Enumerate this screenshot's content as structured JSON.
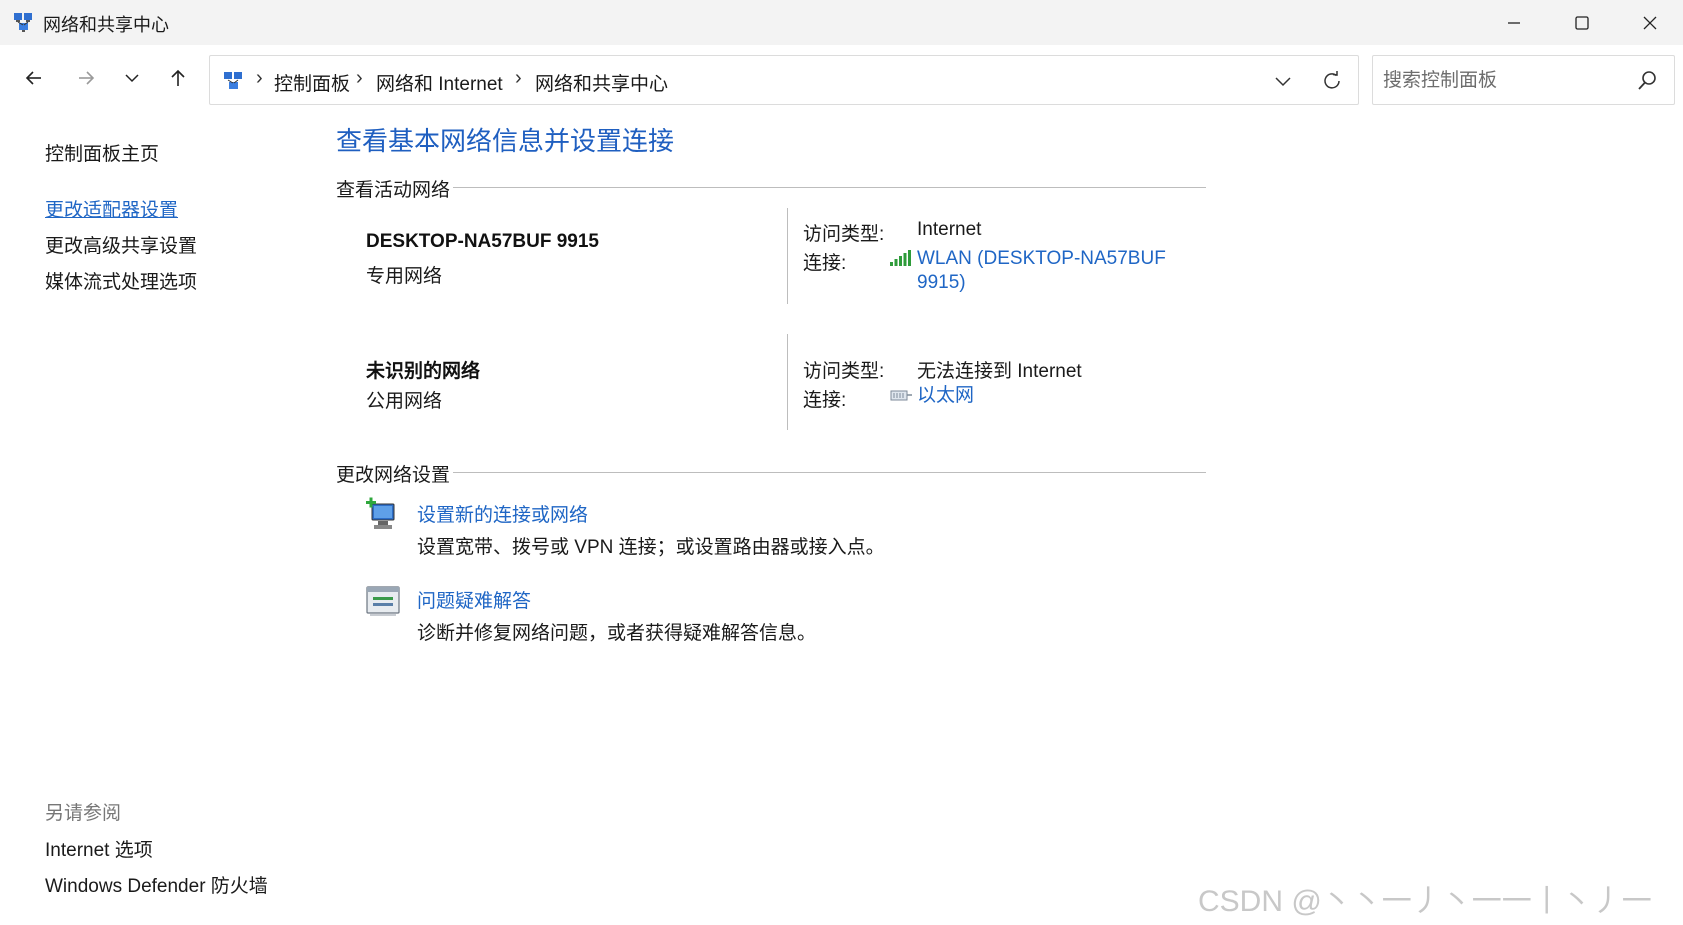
{
  "window": {
    "title": "网络和共享中心"
  },
  "address": {
    "crumbs": [
      "控制面板",
      "网络和 Internet",
      "网络和共享中心"
    ],
    "separator": "›"
  },
  "search": {
    "placeholder": "搜索控制面板"
  },
  "sidebar": {
    "home": "控制面板主页",
    "items": [
      "更改适配器设置",
      "更改高级共享设置",
      "媒体流式处理选项"
    ],
    "see_also_title": "另请参阅",
    "see_also": [
      "Internet 选项",
      "Windows Defender 防火墙"
    ]
  },
  "main": {
    "title": "查看基本网络信息并设置连接",
    "active_section": "查看活动网络",
    "networks": [
      {
        "name": "DESKTOP-NA57BUF 9915",
        "type": "专用网络",
        "access_label": "访问类型:",
        "access_value": "Internet",
        "conn_label": "连接:",
        "conn_line1": "WLAN (DESKTOP-NA57BUF",
        "conn_line2": "9915)",
        "conn_icon": "wifi-signal-icon"
      },
      {
        "name": "未识别的网络",
        "type": "公用网络",
        "access_label": "访问类型:",
        "access_value": "无法连接到 Internet",
        "conn_label": "连接:",
        "conn_line1": "以太网",
        "conn_icon": "ethernet-icon"
      }
    ],
    "change_section": "更改网络设置",
    "tasks": [
      {
        "link": "设置新的连接或网络",
        "desc": "设置宽带、拨号或 VPN 连接；或设置路由器或接入点。",
        "icon": "new-connection-icon"
      },
      {
        "link": "问题疑难解答",
        "desc": "诊断并修复网络问题，或者获得疑难解答信息。",
        "icon": "troubleshoot-icon"
      }
    ]
  },
  "watermark": "CSDN @丶丶一丿丶一一丨丶丿一",
  "colors": {
    "link": "#1f66c5",
    "title_blue": "#1f5fc0",
    "titlebar": "#f3f3f3"
  }
}
